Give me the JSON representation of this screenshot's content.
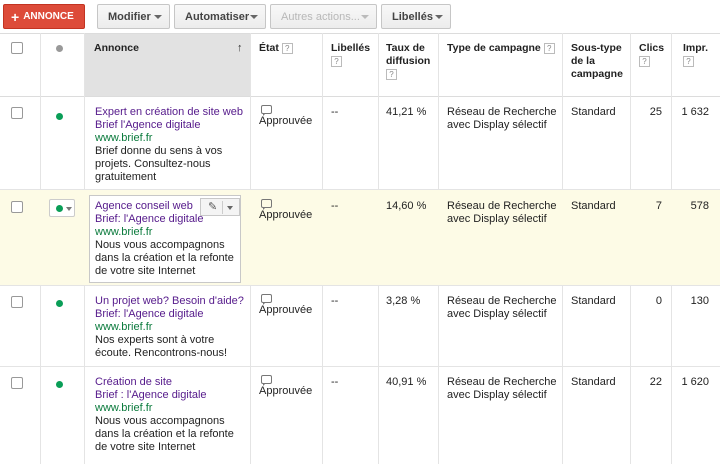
{
  "toolbar": {
    "new_ad": "ANNONCE",
    "modify": "Modifier",
    "automate": "Automatiser",
    "other_actions": "Autres actions...",
    "labels": "Libellés"
  },
  "columns": {
    "annonce": "Annonce",
    "etat": "État",
    "libelles": "Libellés",
    "taux_l1": "Taux de",
    "taux_l2": "diffusion",
    "type": "Type de campagne",
    "sous_type_l1": "Sous-type",
    "sous_type_l2": "de la",
    "sous_type_l3": "campagne",
    "clics": "Clics",
    "impr": "Impr.",
    "help": "?"
  },
  "rows": [
    {
      "title": "Expert en création de site web",
      "line2": "Brief l'Agence digitale",
      "url": "www.brief.fr",
      "desc1": "Brief donne du sens à vos",
      "desc2": "projets. Consultez-nous",
      "desc3": "gratuitement",
      "status": "Approuvée",
      "labels": "--",
      "rate": "41,21 %",
      "type1": "Réseau de Recherche",
      "type2": "avec Display sélectif",
      "subtype": "Standard",
      "clicks": "25",
      "impr": "1 632"
    },
    {
      "title": "Agence conseil web",
      "line2": "Brief: l'Agence digitale",
      "url": "www.brief.fr",
      "desc1": "Nous vous accompagnons",
      "desc2": "dans la création et la refonte",
      "desc3": "de votre site Internet",
      "status": "Approuvée",
      "labels": "--",
      "rate": "14,60 %",
      "type1": "Réseau de Recherche",
      "type2": "avec Display sélectif",
      "subtype": "Standard",
      "clicks": "7",
      "impr": "578"
    },
    {
      "title": "Un projet web? Besoin d'aide?",
      "line2": "Brief: l'Agence digitale",
      "url": "www.brief.fr",
      "desc1": "Nos experts sont à votre",
      "desc2": "écoute. Rencontrons-nous!",
      "desc3": "",
      "status": "Approuvée",
      "labels": "--",
      "rate": "3,28 %",
      "type1": "Réseau de Recherche",
      "type2": "avec Display sélectif",
      "subtype": "Standard",
      "clicks": "0",
      "impr": "130"
    },
    {
      "title": "Création de site",
      "line2": "Brief : l'Agence digitale",
      "url": "www.brief.fr",
      "desc1": "Nous vous accompagnons",
      "desc2": "dans la création et la refonte",
      "desc3": "de votre site Internet",
      "status": "Approuvée",
      "labels": "--",
      "rate": "40,91 %",
      "type1": "Réseau de Recherche",
      "type2": "avec Display sélectif",
      "subtype": "Standard",
      "clicks": "22",
      "impr": "1 620"
    }
  ],
  "colors": {
    "accent": "#dd4b39",
    "title_link": "#551a8b",
    "url": "#0a7a3c",
    "status_dot": "#0a9e57",
    "highlight_row": "#fdfbe6"
  }
}
